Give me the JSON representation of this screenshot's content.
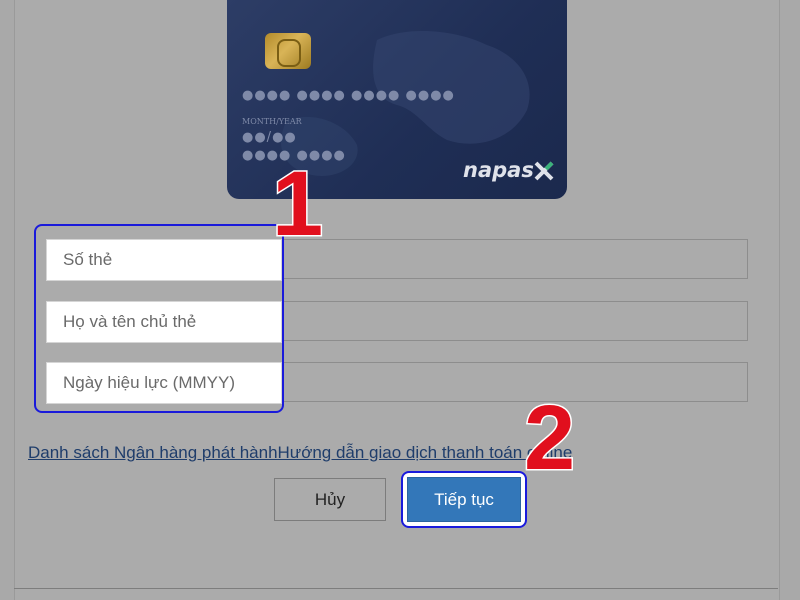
{
  "card": {
    "number_mask": "●●●● ●●●● ●●●● ●●●●",
    "month_year_label": "MONTH/YEAR",
    "expiry_mask": "●●/●●",
    "extra_mask": "●●●● ●●●●",
    "brand_name": "napas"
  },
  "form": {
    "card_number_placeholder": "Số thẻ",
    "holder_name_placeholder": "Họ và tên chủ thẻ",
    "valid_date_placeholder": "Ngày hiệu lực (MMYY)"
  },
  "links": {
    "bank_list": "Danh sách Ngân hàng phát hành",
    "payment_guide": "Hướng dẫn giao dịch thanh toán online"
  },
  "buttons": {
    "cancel_label": "Hủy",
    "continue_label": "Tiếp tục"
  },
  "annotations": {
    "step_1": "1",
    "step_2": "2",
    "highlight_color": "#1a1adb",
    "number_color": "#e10f1d"
  },
  "colors": {
    "card_background": "#25355e",
    "continue_button": "#3377b9",
    "link": "#1f3d6b"
  }
}
